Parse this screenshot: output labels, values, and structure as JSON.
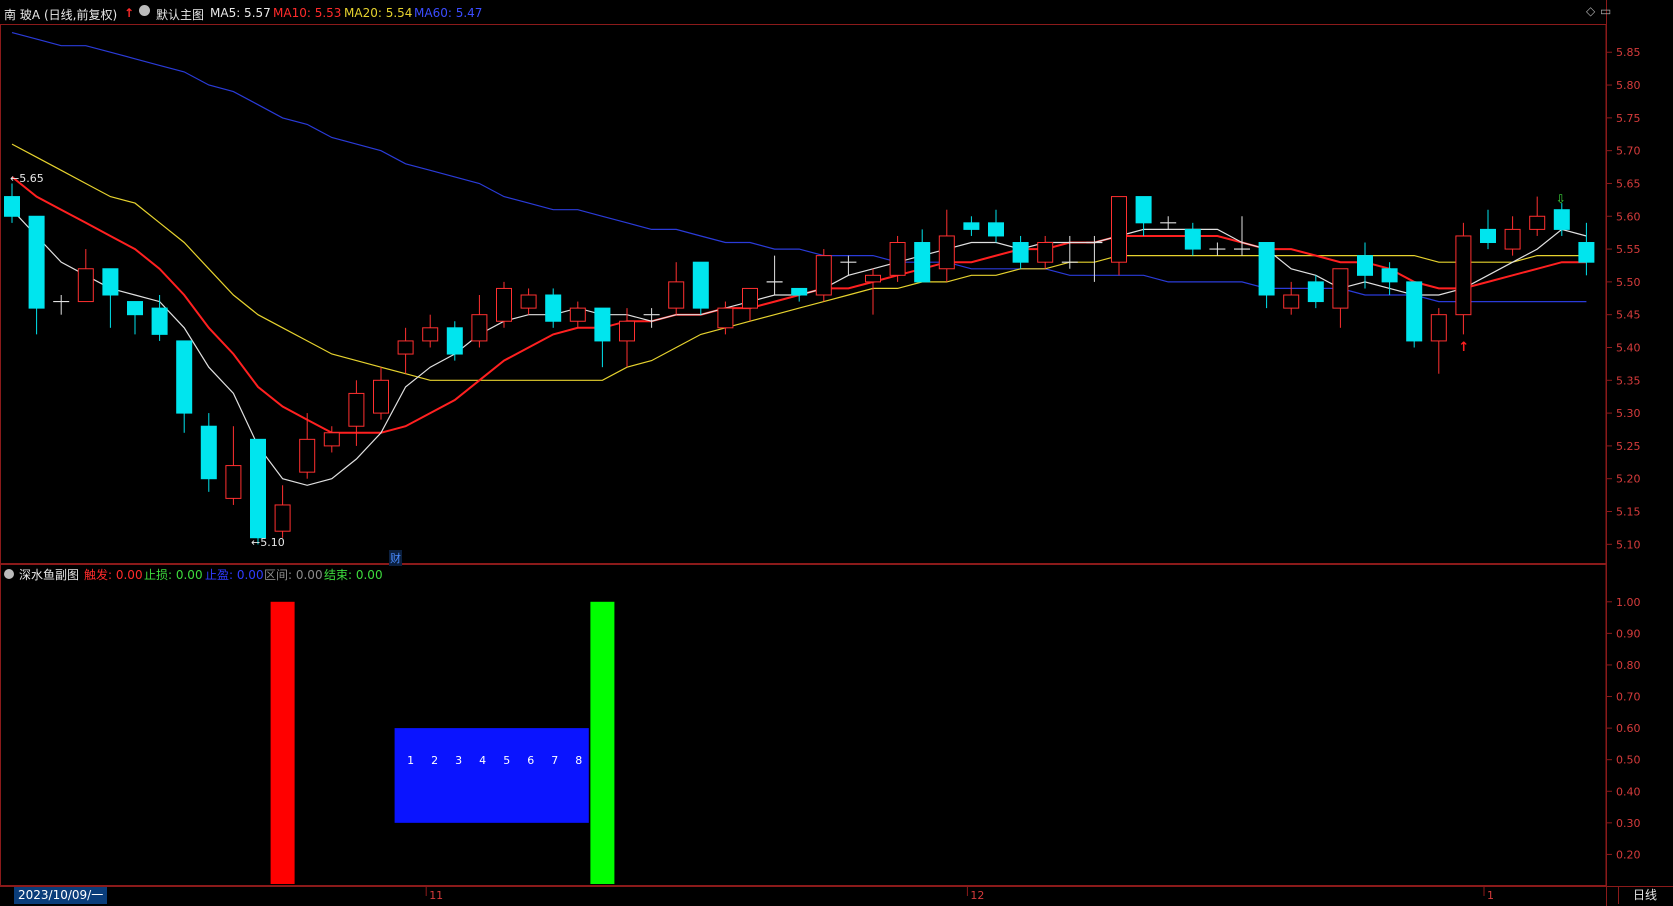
{
  "header": {
    "stock_name": "南 玻A",
    "period": "(日线,前复权)",
    "main_chart_label": "默认主图",
    "ma5_label": "MA5: 5.57",
    "ma10_label": "MA10: 5.53",
    "ma20_label": "MA20: 5.54",
    "ma60_label": "MA60: 5.47",
    "diamond_icon": "diamond-icon",
    "restore_icon": "restore-icon"
  },
  "colors": {
    "ma5": "#e0e0e0",
    "ma10": "#ff2020",
    "ma20": "#e6d22e",
    "ma60": "#2a3bd8",
    "up": "#ff3030",
    "down": "#00e5ee",
    "axis": "#8b1a1a",
    "axis_text": "#d53b3b"
  },
  "main_axis": {
    "ticks": [
      "5.85",
      "5.80",
      "5.75",
      "5.70",
      "5.65",
      "5.60",
      "5.55",
      "5.50",
      "5.45",
      "5.40",
      "5.35",
      "5.30",
      "5.25",
      "5.20",
      "5.15",
      "5.10"
    ]
  },
  "annotations": {
    "high_marker": "←5.65",
    "low_marker": "←5.10",
    "finance_marker": "财"
  },
  "sub_chart": {
    "title": "深水鱼副图",
    "trigger_label": "触发: 0.00",
    "stop_loss_label": "止损: 0.00",
    "stop_profit_label": "止盈: 0.00",
    "range_label": "区间: 0.00",
    "end_label": "结束: 0.00",
    "ticks": [
      "1.00",
      "0.90",
      "0.80",
      "0.70",
      "0.60",
      "0.50",
      "0.40",
      "0.30",
      "0.20"
    ],
    "count_labels": [
      "1",
      "2",
      "3",
      "4",
      "5",
      "6",
      "7",
      "8"
    ],
    "bars": [
      {
        "name": "trigger-bar",
        "color": "#ff0000",
        "index": 11,
        "low": 0,
        "high": 1.0
      },
      {
        "name": "range-block",
        "color": "#0a14ff",
        "index_start": 16,
        "index_end": 23,
        "low": 0.3,
        "high": 0.6
      },
      {
        "name": "end-bar",
        "color": "#00ff00",
        "index": 24,
        "low": 0,
        "high": 1.0
      }
    ]
  },
  "x_axis": {
    "date": "2023/10/09/一",
    "month_marks": [
      {
        "label": "11",
        "index": 17
      },
      {
        "label": "12",
        "index": 39
      },
      {
        "label": "1",
        "index": 60
      }
    ],
    "day_line": "日线"
  },
  "chart_data": {
    "type": "candlestick",
    "series": [
      {
        "name": "K",
        "candles": [
          [
            5.63,
            5.6,
            5.65,
            5.59
          ],
          [
            5.6,
            5.46,
            5.6,
            5.42
          ],
          [
            5.47,
            5.47,
            5.48,
            5.45
          ],
          [
            5.47,
            5.52,
            5.55,
            5.47
          ],
          [
            5.52,
            5.48,
            5.52,
            5.43
          ],
          [
            5.47,
            5.45,
            5.47,
            5.42
          ],
          [
            5.46,
            5.42,
            5.48,
            5.41
          ],
          [
            5.41,
            5.3,
            5.41,
            5.27
          ],
          [
            5.28,
            5.2,
            5.3,
            5.18
          ],
          [
            5.17,
            5.22,
            5.28,
            5.16
          ],
          [
            5.26,
            5.11,
            5.26,
            5.1
          ],
          [
            5.12,
            5.16,
            5.19,
            5.11
          ],
          [
            5.21,
            5.26,
            5.3,
            5.2
          ],
          [
            5.25,
            5.27,
            5.28,
            5.24
          ],
          [
            5.28,
            5.33,
            5.35,
            5.25
          ],
          [
            5.3,
            5.35,
            5.37,
            5.29
          ],
          [
            5.39,
            5.41,
            5.43,
            5.36
          ],
          [
            5.41,
            5.43,
            5.45,
            5.4
          ],
          [
            5.43,
            5.39,
            5.44,
            5.38
          ],
          [
            5.41,
            5.45,
            5.48,
            5.4
          ],
          [
            5.44,
            5.49,
            5.5,
            5.43
          ],
          [
            5.46,
            5.48,
            5.49,
            5.45
          ],
          [
            5.48,
            5.44,
            5.49,
            5.43
          ],
          [
            5.44,
            5.46,
            5.47,
            5.43
          ],
          [
            5.46,
            5.41,
            5.46,
            5.37
          ],
          [
            5.41,
            5.44,
            5.46,
            5.37
          ],
          [
            5.45,
            5.45,
            5.46,
            5.43
          ],
          [
            5.46,
            5.5,
            5.53,
            5.45
          ],
          [
            5.53,
            5.46,
            5.53,
            5.45
          ],
          [
            5.43,
            5.46,
            5.47,
            5.42
          ],
          [
            5.46,
            5.49,
            5.49,
            5.44
          ],
          [
            5.5,
            5.5,
            5.54,
            5.48
          ],
          [
            5.49,
            5.48,
            5.49,
            5.47
          ],
          [
            5.48,
            5.54,
            5.55,
            5.47
          ],
          [
            5.53,
            5.53,
            5.54,
            5.51
          ],
          [
            5.5,
            5.51,
            5.52,
            5.45
          ],
          [
            5.51,
            5.56,
            5.57,
            5.5
          ],
          [
            5.56,
            5.5,
            5.58,
            5.5
          ],
          [
            5.52,
            5.57,
            5.61,
            5.5
          ],
          [
            5.59,
            5.58,
            5.6,
            5.57
          ],
          [
            5.59,
            5.57,
            5.61,
            5.56
          ],
          [
            5.56,
            5.53,
            5.57,
            5.52
          ],
          [
            5.53,
            5.56,
            5.57,
            5.52
          ],
          [
            5.53,
            5.53,
            5.57,
            5.52
          ],
          [
            5.56,
            5.56,
            5.57,
            5.5
          ],
          [
            5.53,
            5.63,
            5.63,
            5.51
          ],
          [
            5.63,
            5.59,
            5.63,
            5.57
          ],
          [
            5.59,
            5.59,
            5.6,
            5.58
          ],
          [
            5.58,
            5.55,
            5.59,
            5.54
          ],
          [
            5.55,
            5.55,
            5.56,
            5.54
          ],
          [
            5.55,
            5.55,
            5.6,
            5.54
          ],
          [
            5.56,
            5.48,
            5.56,
            5.46
          ],
          [
            5.46,
            5.48,
            5.5,
            5.45
          ],
          [
            5.5,
            5.47,
            5.51,
            5.46
          ],
          [
            5.46,
            5.52,
            5.52,
            5.43
          ],
          [
            5.54,
            5.51,
            5.56,
            5.49
          ],
          [
            5.52,
            5.5,
            5.53,
            5.48
          ],
          [
            5.5,
            5.41,
            5.5,
            5.4
          ],
          [
            5.41,
            5.45,
            5.46,
            5.36
          ],
          [
            5.45,
            5.57,
            5.59,
            5.42
          ],
          [
            5.58,
            5.56,
            5.61,
            5.55
          ],
          [
            5.55,
            5.58,
            5.6,
            5.54
          ],
          [
            5.58,
            5.6,
            5.63,
            5.57
          ],
          [
            5.61,
            5.58,
            5.62,
            5.57
          ],
          [
            5.56,
            5.53,
            5.59,
            5.51
          ]
        ]
      },
      {
        "name": "MA5",
        "values": [
          5.61,
          5.57,
          5.53,
          5.51,
          5.49,
          5.48,
          5.47,
          5.43,
          5.37,
          5.33,
          5.25,
          5.2,
          5.19,
          5.2,
          5.23,
          5.27,
          5.34,
          5.37,
          5.39,
          5.42,
          5.44,
          5.45,
          5.45,
          5.46,
          5.45,
          5.45,
          5.44,
          5.45,
          5.45,
          5.46,
          5.47,
          5.48,
          5.48,
          5.49,
          5.51,
          5.52,
          5.53,
          5.54,
          5.55,
          5.56,
          5.56,
          5.55,
          5.56,
          5.56,
          5.56,
          5.57,
          5.58,
          5.58,
          5.58,
          5.58,
          5.56,
          5.55,
          5.52,
          5.51,
          5.49,
          5.5,
          5.49,
          5.48,
          5.48,
          5.49,
          5.51,
          5.53,
          5.55,
          5.58,
          5.57
        ]
      },
      {
        "name": "MA10",
        "values": [
          5.66,
          5.63,
          5.61,
          5.59,
          5.57,
          5.55,
          5.52,
          5.48,
          5.43,
          5.39,
          5.34,
          5.31,
          5.29,
          5.27,
          5.27,
          5.27,
          5.28,
          5.3,
          5.32,
          5.35,
          5.38,
          5.4,
          5.42,
          5.43,
          5.43,
          5.44,
          5.44,
          5.45,
          5.45,
          5.46,
          5.46,
          5.47,
          5.48,
          5.49,
          5.49,
          5.5,
          5.51,
          5.52,
          5.53,
          5.53,
          5.54,
          5.55,
          5.55,
          5.56,
          5.56,
          5.57,
          5.57,
          5.57,
          5.57,
          5.57,
          5.56,
          5.55,
          5.55,
          5.54,
          5.53,
          5.53,
          5.52,
          5.5,
          5.49,
          5.49,
          5.5,
          5.51,
          5.52,
          5.53,
          5.53
        ]
      },
      {
        "name": "MA20",
        "values": [
          5.71,
          5.69,
          5.67,
          5.65,
          5.63,
          5.62,
          5.59,
          5.56,
          5.52,
          5.48,
          5.45,
          5.43,
          5.41,
          5.39,
          5.38,
          5.37,
          5.36,
          5.35,
          5.35,
          5.35,
          5.35,
          5.35,
          5.35,
          5.35,
          5.35,
          5.37,
          5.38,
          5.4,
          5.42,
          5.43,
          5.44,
          5.45,
          5.46,
          5.47,
          5.48,
          5.49,
          5.49,
          5.5,
          5.5,
          5.51,
          5.51,
          5.52,
          5.52,
          5.53,
          5.53,
          5.54,
          5.54,
          5.54,
          5.54,
          5.54,
          5.54,
          5.54,
          5.54,
          5.54,
          5.54,
          5.54,
          5.54,
          5.54,
          5.53,
          5.53,
          5.53,
          5.53,
          5.54,
          5.54,
          5.54
        ]
      },
      {
        "name": "MA60",
        "values": [
          5.88,
          5.87,
          5.86,
          5.86,
          5.85,
          5.84,
          5.83,
          5.82,
          5.8,
          5.79,
          5.77,
          5.75,
          5.74,
          5.72,
          5.71,
          5.7,
          5.68,
          5.67,
          5.66,
          5.65,
          5.63,
          5.62,
          5.61,
          5.61,
          5.6,
          5.59,
          5.58,
          5.58,
          5.57,
          5.56,
          5.56,
          5.55,
          5.55,
          5.54,
          5.54,
          5.54,
          5.53,
          5.53,
          5.53,
          5.52,
          5.52,
          5.52,
          5.52,
          5.51,
          5.51,
          5.51,
          5.51,
          5.5,
          5.5,
          5.5,
          5.5,
          5.49,
          5.49,
          5.49,
          5.49,
          5.48,
          5.48,
          5.48,
          5.47,
          5.47,
          5.47,
          5.47,
          5.47,
          5.47,
          5.47
        ]
      }
    ],
    "ylim": [
      5.07,
      5.89
    ],
    "sub_ylim": [
      0.1,
      1.05
    ]
  }
}
